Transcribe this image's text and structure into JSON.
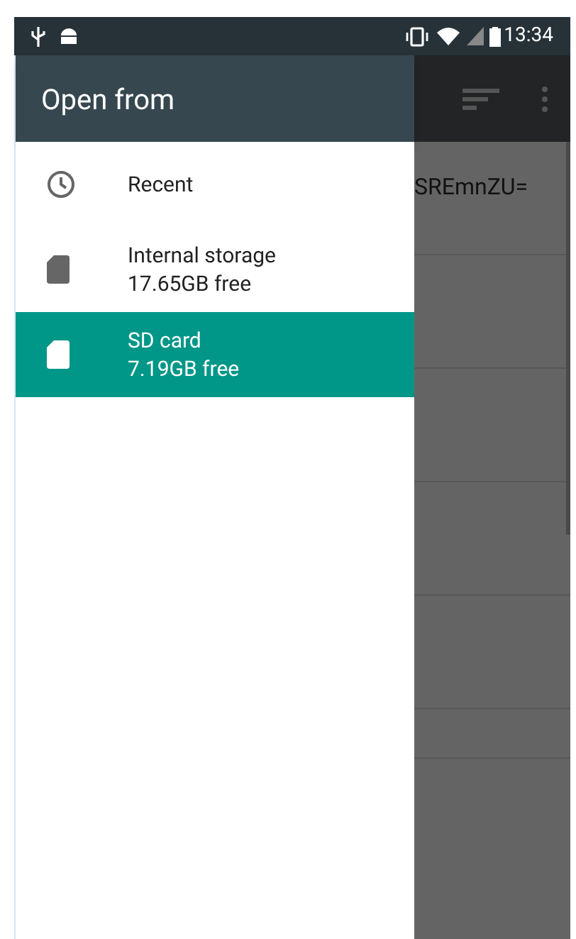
{
  "status_bar": {
    "time": "13:34"
  },
  "drawer": {
    "title": "Open from",
    "items": [
      {
        "kind": "recent",
        "title": "Recent",
        "selected": false
      },
      {
        "kind": "storage",
        "title": "Internal storage",
        "subtitle": "17.65GB free",
        "selected": false
      },
      {
        "kind": "storage",
        "title": "SD card",
        "subtitle": "7.19GB free",
        "selected": true
      }
    ]
  },
  "background_list": {
    "rows": [
      {
        "text": "SREmnZU="
      }
    ]
  }
}
